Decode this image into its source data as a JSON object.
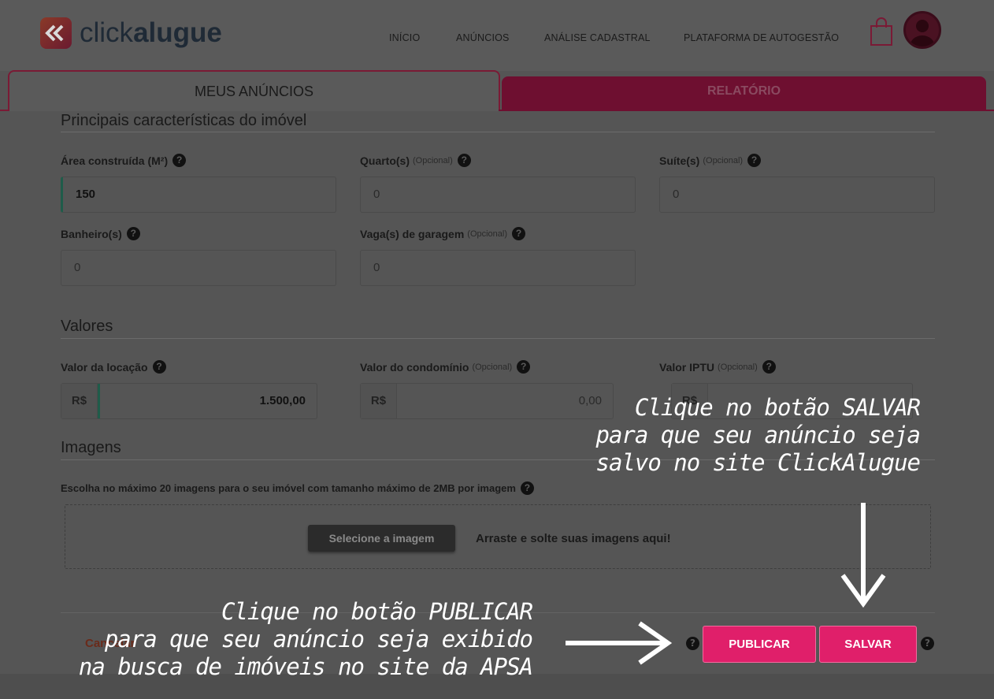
{
  "brand": {
    "light": "click",
    "bold": "alugue"
  },
  "nav": {
    "items": [
      {
        "label": "INÍCIO"
      },
      {
        "label": "ANÚNCIOS"
      },
      {
        "label": "ANÁLISE CADASTRAL"
      },
      {
        "label": "PLATAFORMA DE AUTOGESTÃO"
      }
    ]
  },
  "tabs": {
    "active": "MEUS ANÚNCIOS",
    "inactive": "RELATÓRIO"
  },
  "features": {
    "title": "Principais características do imóvel",
    "area": {
      "label": "Área construída (M²)",
      "value": "150"
    },
    "quartos": {
      "label": "Quarto(s)",
      "optional": "(Opcional)",
      "value": "0"
    },
    "suites": {
      "label": "Suíte(s)",
      "optional": "(Opcional)",
      "value": "0"
    },
    "banheiros": {
      "label": "Banheiro(s)",
      "value": "0"
    },
    "vagas": {
      "label": "Vaga(s) de garagem",
      "optional": "(Opcional)",
      "value": "0"
    }
  },
  "values": {
    "title": "Valores",
    "locacao": {
      "label": "Valor da locação",
      "prefix": "R$",
      "value": "1.500,00"
    },
    "condominio": {
      "label": "Valor do condomínio",
      "optional": "(Opcional)",
      "prefix": "R$",
      "value": "0,00"
    },
    "iptu": {
      "label": "Valor IPTU",
      "optional": "(Opcional)",
      "prefix": "R$"
    }
  },
  "images": {
    "title": "Imagens",
    "hint": "Escolha no máximo 20 imagens para o seu imóvel com tamanho máximo de 2MB por imagem",
    "select_label": "Selecione a imagem",
    "drop_label": "Arraste e solte suas imagens aqui!"
  },
  "actions": {
    "cancel": "Cancelar",
    "publish": "PUBLICAR",
    "save": "SALVAR"
  },
  "help_glyph": "?",
  "annotations": {
    "save_note": "Clique no botão SALVAR\npara que seu anúncio seja\n salvo no site ClickAlugue",
    "publish_note": "Clique no botão PUBLICAR\npara que seu anúncio seja exibido\nna busca de imóveis no site da APSA"
  },
  "colors": {
    "accent": "#e01f6a",
    "tab_inactive": "#6e0f30",
    "filled_marker": "#1f5c4a",
    "overlay": "#555555"
  }
}
